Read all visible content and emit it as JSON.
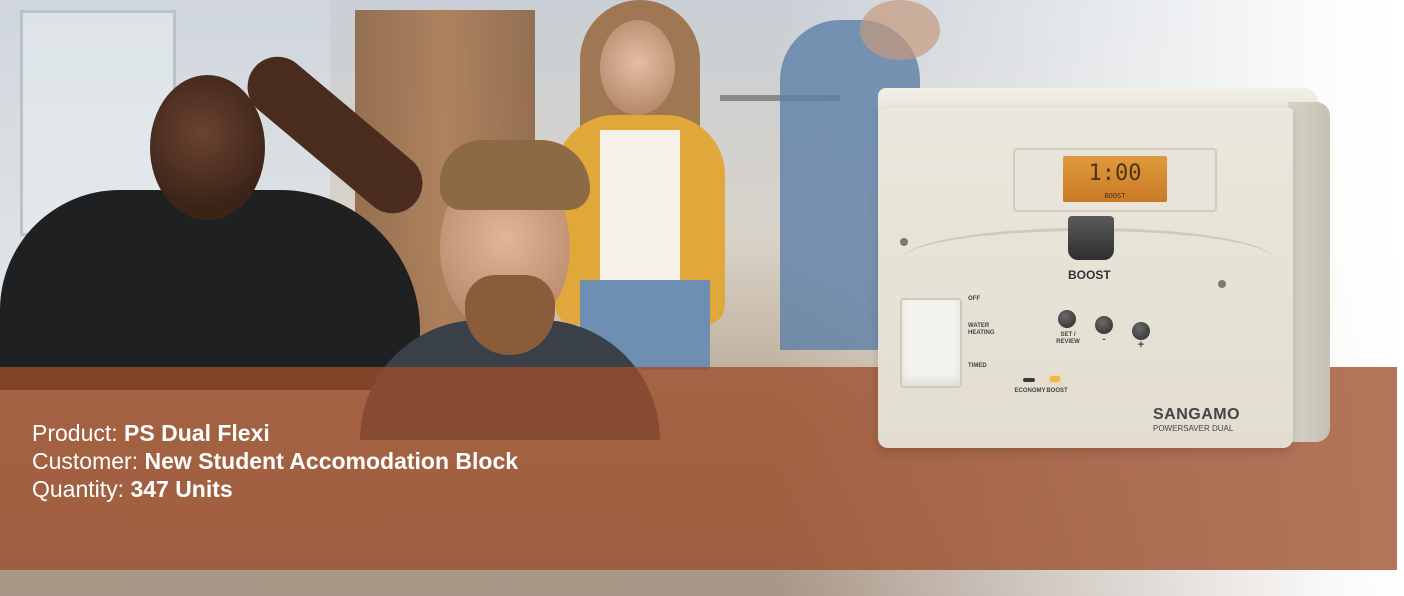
{
  "device": {
    "lcd_display": "1:00",
    "lcd_sub": "BOOST",
    "boost_label": "BOOST",
    "switch_labels": [
      "OFF",
      "WATER HEATING",
      "TIMED"
    ],
    "set_review_label": "SET / REVIEW",
    "minus_label": "-",
    "plus_label": "+",
    "economy_label": "ECONOMY",
    "boost_led_label": "BOOST",
    "brand_name": "SANGAMO",
    "brand_sub": "POWERSAVER DUAL"
  },
  "info": {
    "product_label": "Product:",
    "product_value": "PS Dual Flexi",
    "customer_label": "Customer:",
    "customer_value": "New Student Accomodation Block",
    "quantity_label": "Quantity:",
    "quantity_value": "347 Units"
  },
  "colors": {
    "banner": "#9c4e2c",
    "text": "#ffffff",
    "lcd": "#d98a30"
  }
}
